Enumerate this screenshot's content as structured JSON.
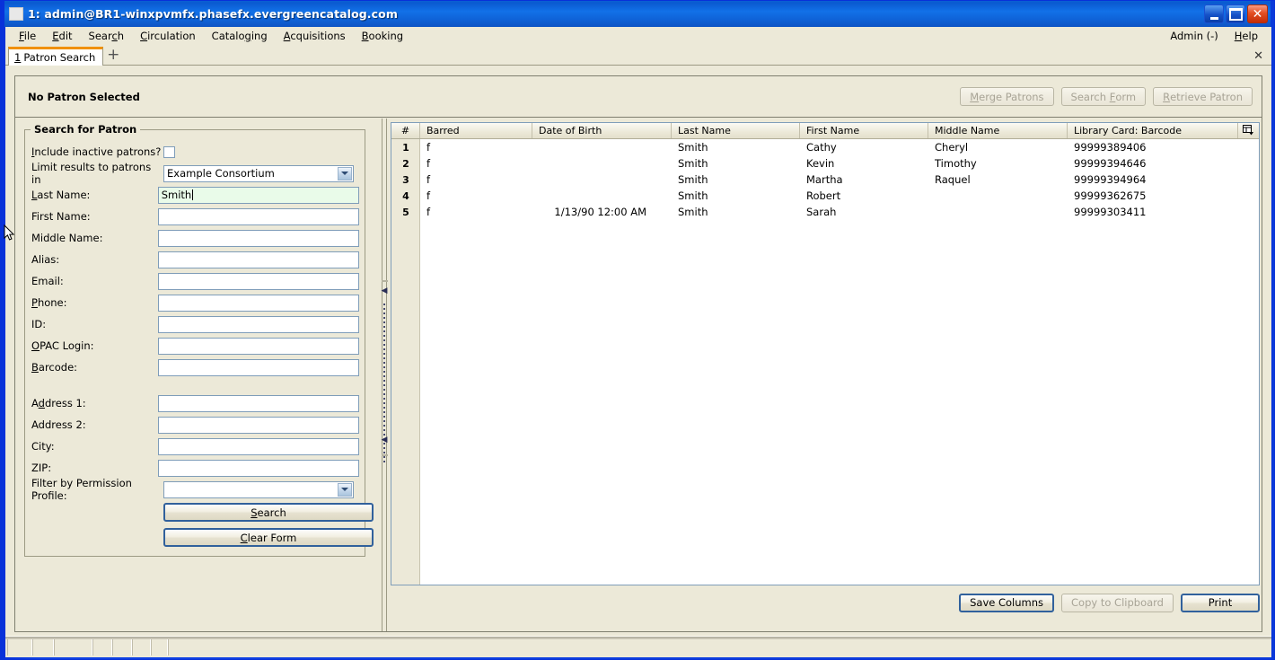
{
  "window": {
    "title": "1: admin@BR1-winxpvmfx.phasefx.evergreencatalog.com",
    "minimize_label": "",
    "maximize_label": "",
    "close_label": "✕"
  },
  "menubar": {
    "items": [
      {
        "label": "File",
        "accel": "F"
      },
      {
        "label": "Edit",
        "accel": "E"
      },
      {
        "label": "Search",
        "accel": "c"
      },
      {
        "label": "Circulation",
        "accel": "C"
      },
      {
        "label": "Cataloging",
        "accel": "g"
      },
      {
        "label": "Acquisitions",
        "accel": "A"
      },
      {
        "label": "Booking",
        "accel": "B"
      }
    ],
    "right_items": [
      {
        "label": "Admin (-)"
      },
      {
        "label": "Help"
      }
    ]
  },
  "tabbar": {
    "tabs": [
      {
        "number": "1",
        "label": "Patron Search"
      }
    ],
    "new_tab_label": "+",
    "close_label": "✕"
  },
  "patron_header": {
    "status": "No Patron Selected",
    "buttons": [
      {
        "label": "Merge Patrons",
        "disabled": true
      },
      {
        "label": "Search Form",
        "disabled": true
      },
      {
        "label": "Retrieve Patron",
        "disabled": true
      }
    ]
  },
  "search_form": {
    "legend": "Search for Patron",
    "include_inactive_label": "Include inactive patrons?",
    "include_inactive_checked": false,
    "limit_label": "Limit results to patrons in",
    "limit_value": "Example Consortium",
    "fields": [
      {
        "label": "Last Name:",
        "value": "Smith",
        "focused": true
      },
      {
        "label": "First Name:",
        "value": "",
        "focused": false
      },
      {
        "label": "Middle Name:",
        "value": "",
        "focused": false
      },
      {
        "label": "Alias:",
        "value": "",
        "focused": false
      },
      {
        "label": "Email:",
        "value": "",
        "focused": false
      },
      {
        "label": "Phone:",
        "value": "",
        "focused": false
      },
      {
        "label": "ID:",
        "value": "",
        "focused": false
      },
      {
        "label": "OPAC Login:",
        "value": "",
        "focused": false
      },
      {
        "label": "Barcode:",
        "value": "",
        "focused": false
      }
    ],
    "address_fields": [
      {
        "label": "Address 1:",
        "value": ""
      },
      {
        "label": "Address 2:",
        "value": ""
      },
      {
        "label": "City:",
        "value": ""
      },
      {
        "label": "ZIP:",
        "value": ""
      }
    ],
    "permission_label": "Filter by Permission Profile:",
    "permission_value": "",
    "search_button": "Search",
    "clear_button": "Clear Form"
  },
  "results": {
    "columns": [
      {
        "key": "num",
        "label": "#"
      },
      {
        "key": "barred",
        "label": "Barred"
      },
      {
        "key": "dob",
        "label": "Date of Birth"
      },
      {
        "key": "last",
        "label": "Last Name"
      },
      {
        "key": "first",
        "label": "First Name"
      },
      {
        "key": "middle",
        "label": "Middle Name"
      },
      {
        "key": "card",
        "label": "Library Card: Barcode"
      }
    ],
    "column_picker_icon": "column-picker-icon",
    "rows": [
      {
        "num": "1",
        "barred": "f",
        "dob": "",
        "last": "Smith",
        "first": "Cathy",
        "middle": "Cheryl",
        "card": "99999389406"
      },
      {
        "num": "2",
        "barred": "f",
        "dob": "",
        "last": "Smith",
        "first": "Kevin",
        "middle": "Timothy",
        "card": "99999394646"
      },
      {
        "num": "3",
        "barred": "f",
        "dob": "",
        "last": "Smith",
        "first": "Martha",
        "middle": "Raquel",
        "card": "99999394964"
      },
      {
        "num": "4",
        "barred": "f",
        "dob": "",
        "last": "Smith",
        "first": "Robert",
        "middle": "",
        "card": "99999362675"
      },
      {
        "num": "5",
        "barred": "f",
        "dob": "1/13/90 12:00 AM",
        "last": "Smith",
        "first": "Sarah",
        "middle": "",
        "card": "99999303411"
      }
    ],
    "footer_buttons": [
      {
        "label": "Save Columns",
        "disabled": false,
        "default": true
      },
      {
        "label": "Copy to Clipboard",
        "disabled": true,
        "default": false
      },
      {
        "label": "Print",
        "disabled": false,
        "default": true
      }
    ]
  },
  "statusbar": {
    "panes": [
      "",
      "",
      "",
      "",
      "",
      "",
      "",
      ""
    ]
  },
  "colors": {
    "title_blue": "#0a5ad0",
    "chrome_beige": "#ece9d8",
    "tab_accent": "#f09000",
    "field_border": "#7f9db9",
    "focused_field_bg": "#e9fbe9",
    "default_button_border": "#31619c"
  }
}
